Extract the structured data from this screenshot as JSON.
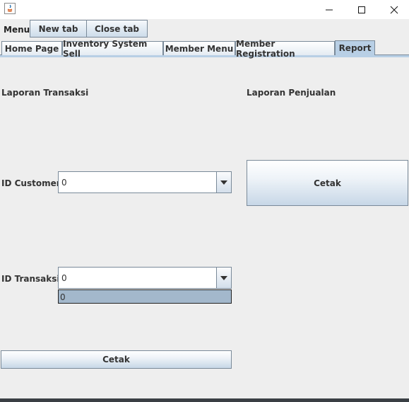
{
  "window": {
    "icon": "java-icon",
    "controls": {
      "minimize_icon": "minimize-icon",
      "maximize_icon": "maximize-icon",
      "close_icon": "close-icon"
    }
  },
  "toolbar": {
    "menu_label": "Menu",
    "new_tab_label": "New tab",
    "close_tab_label": "Close tab"
  },
  "tabs": [
    {
      "label": "Home Page",
      "selected": false
    },
    {
      "label": "Inventory System Sell",
      "selected": false
    },
    {
      "label": "Member Menu",
      "selected": false
    },
    {
      "label": "Member Registration",
      "selected": false
    },
    {
      "label": "Report",
      "selected": true
    }
  ],
  "report": {
    "transaksi_section": {
      "title": "Laporan Transaksi",
      "id_customer_label": "ID Customer",
      "id_customer_value": "0",
      "id_transaksi_label": "ID Transaksi",
      "id_transaksi_value": "0",
      "id_transaksi_options": [
        "0"
      ],
      "print_label": "Cetak"
    },
    "penjualan_section": {
      "title": "Laporan Penjualan",
      "print_label": "Cetak"
    }
  },
  "colors": {
    "background": "#eeeeee",
    "tab_selected": "#b8cfe5",
    "dropdown_highlight": "#a3b8cc",
    "border": "#7a8a99"
  }
}
